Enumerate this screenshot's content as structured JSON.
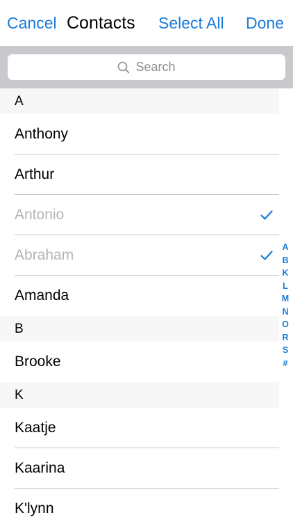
{
  "navbar": {
    "cancel_label": "Cancel",
    "title": "Contacts",
    "select_all_label": "Select All",
    "done_label": "Done"
  },
  "search": {
    "placeholder": "Search"
  },
  "colors": {
    "accent": "#1a7cd9",
    "disabled_text": "#b4b4b8",
    "search_bar_bg": "#c8c8cd",
    "section_header_bg": "#f7f7f7"
  },
  "sections": [
    {
      "letter": "A",
      "contacts": [
        {
          "name": "Anthony",
          "selected": false
        },
        {
          "name": "Arthur",
          "selected": false
        },
        {
          "name": "Antonio",
          "selected": true
        },
        {
          "name": "Abraham",
          "selected": true
        },
        {
          "name": "Amanda",
          "selected": false
        }
      ]
    },
    {
      "letter": "B",
      "contacts": [
        {
          "name": "Brooke",
          "selected": false
        }
      ]
    },
    {
      "letter": "K",
      "contacts": [
        {
          "name": "Kaatje",
          "selected": false
        },
        {
          "name": "Kaarina",
          "selected": false
        },
        {
          "name": "K'lynn",
          "selected": false
        }
      ]
    }
  ],
  "index_letters": [
    "A",
    "B",
    "K",
    "L",
    "M",
    "N",
    "O",
    "R",
    "S",
    "#"
  ]
}
